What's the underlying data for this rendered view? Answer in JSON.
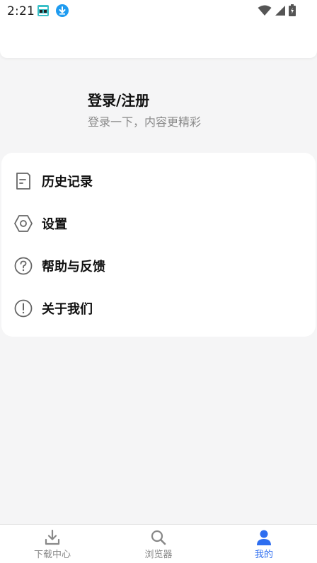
{
  "status_bar": {
    "time": "2:21",
    "icons": [
      "app-notification-icon",
      "download-notification-icon",
      "wifi-icon",
      "cellular-signal-icon",
      "battery-charging-icon"
    ]
  },
  "profile": {
    "title": "登录/注册",
    "subtitle": "登录一下，内容更精彩"
  },
  "menu": {
    "items": [
      {
        "label": "历史记录",
        "icon": "history-icon"
      },
      {
        "label": "设置",
        "icon": "settings-icon"
      },
      {
        "label": "帮助与反馈",
        "icon": "help-icon"
      },
      {
        "label": "关于我们",
        "icon": "info-icon"
      }
    ]
  },
  "bottom_nav": {
    "tabs": [
      {
        "label": "下载中心",
        "icon": "download-icon",
        "active": false
      },
      {
        "label": "浏览器",
        "icon": "search-icon",
        "active": false
      },
      {
        "label": "我的",
        "icon": "user-icon",
        "active": true
      }
    ]
  },
  "colors": {
    "accent": "#2e6ef0",
    "background": "#f5f5f6",
    "card": "#ffffff",
    "muted_text": "#8a8a8a",
    "icon_gray": "#666666",
    "download_badge": "#1e9bf0",
    "app_badge": "#3ac0c8"
  }
}
